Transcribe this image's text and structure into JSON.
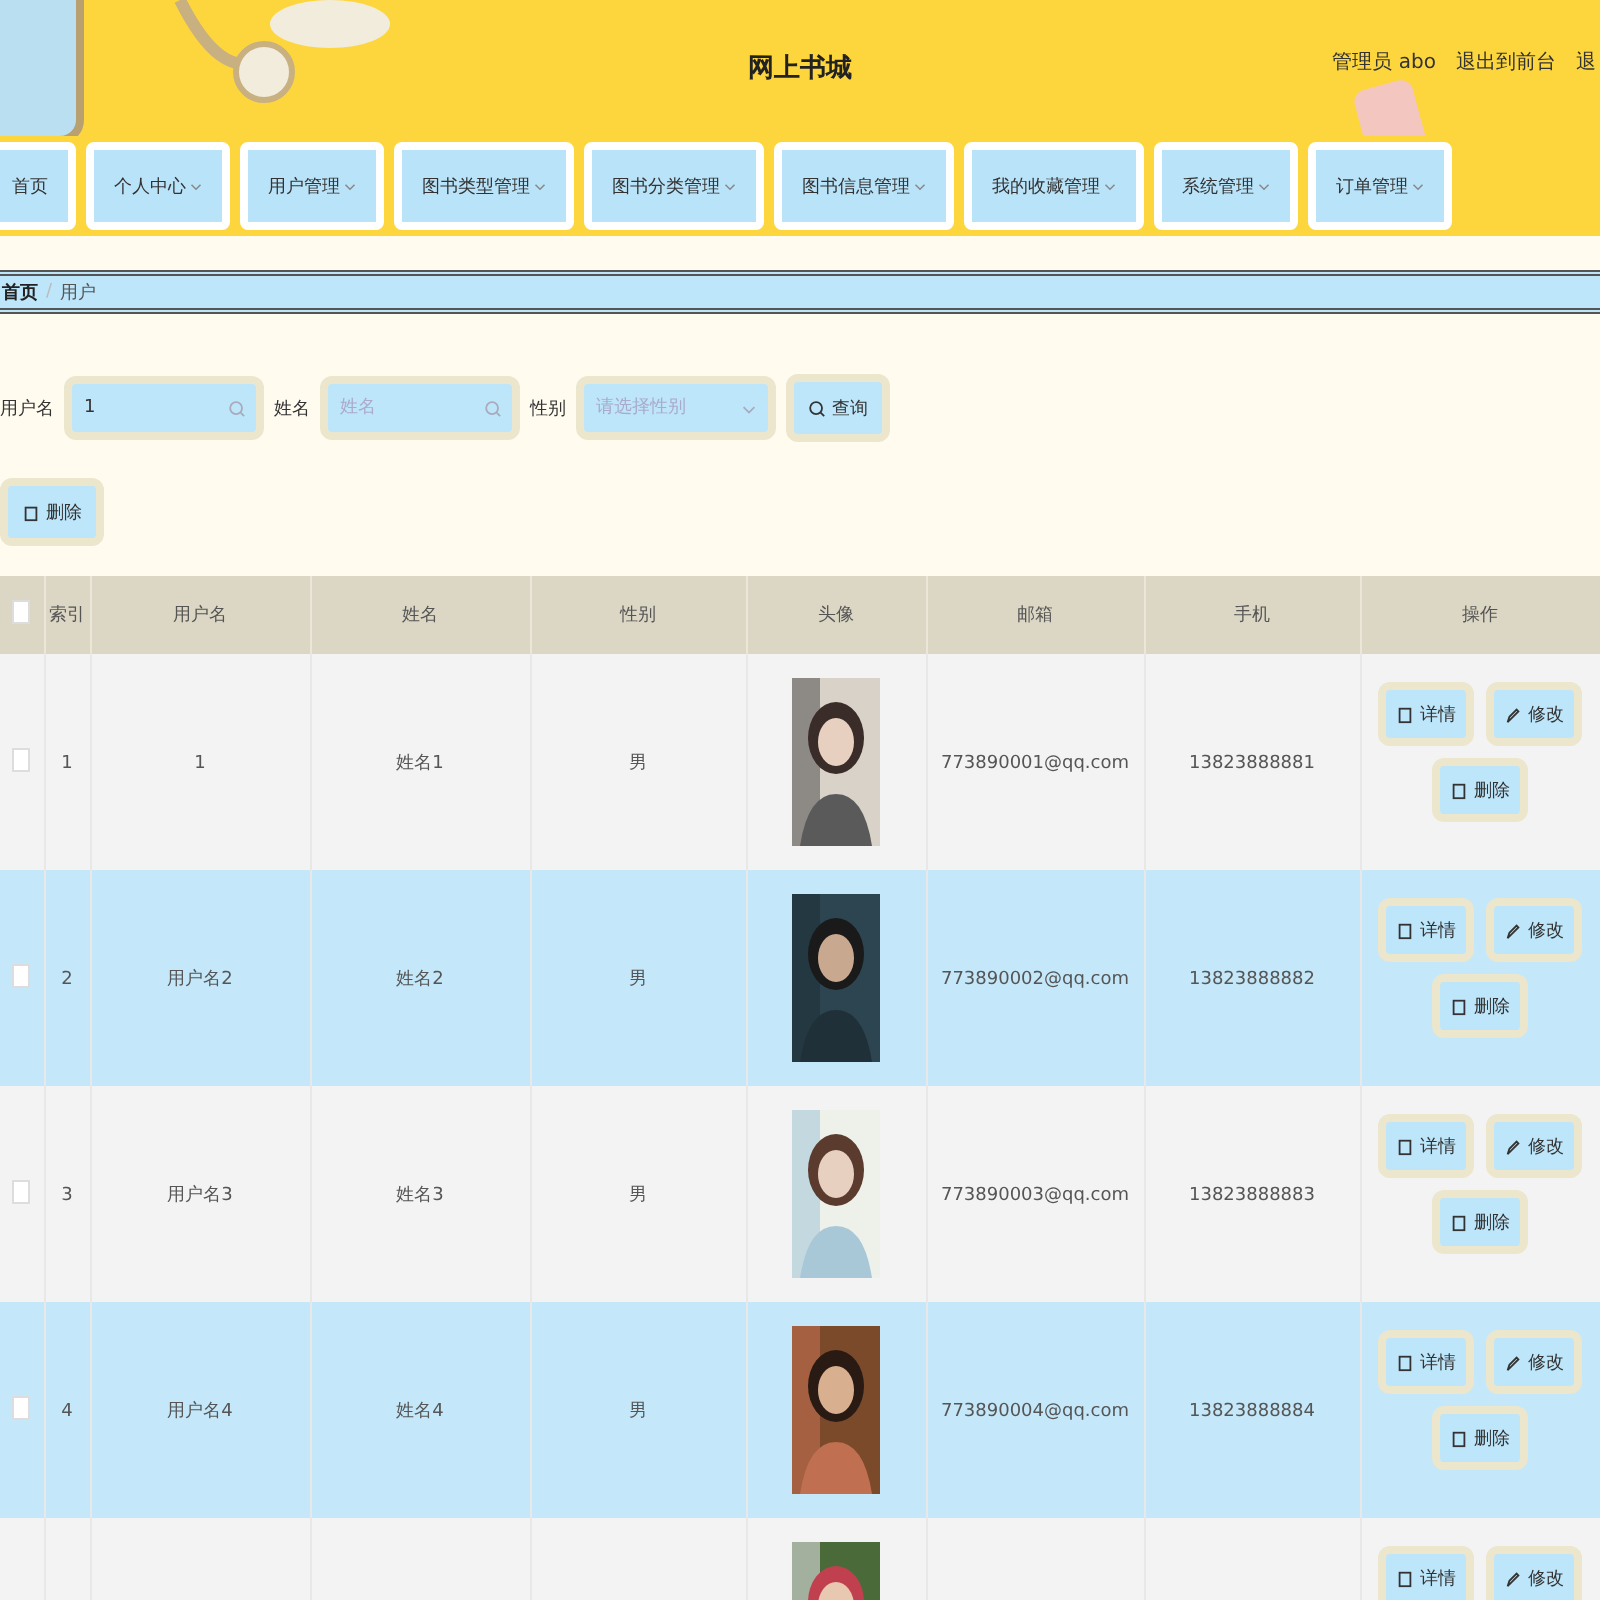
{
  "header": {
    "title": "网上书城",
    "links": [
      "管理员 abo",
      "退出到前台",
      "退"
    ]
  },
  "nav": [
    {
      "label": "首页",
      "dropdown": false
    },
    {
      "label": "个人中心",
      "dropdown": true
    },
    {
      "label": "用户管理",
      "dropdown": true
    },
    {
      "label": "图书类型管理",
      "dropdown": true
    },
    {
      "label": "图书分类管理",
      "dropdown": true
    },
    {
      "label": "图书信息管理",
      "dropdown": true
    },
    {
      "label": "我的收藏管理",
      "dropdown": true
    },
    {
      "label": "系统管理",
      "dropdown": true
    },
    {
      "label": "订单管理",
      "dropdown": true
    }
  ],
  "breadcrumb": {
    "items": [
      "首页",
      "用户"
    ],
    "separator": "/"
  },
  "search": {
    "fields": [
      {
        "label": "用户名",
        "kind": "text",
        "value": "1"
      },
      {
        "label": "姓名",
        "kind": "text",
        "placeholder": "姓名"
      },
      {
        "label": "性别",
        "kind": "select",
        "placeholder": "请选择性别"
      }
    ],
    "button": "查询"
  },
  "bulk_delete": "删除",
  "table": {
    "columns": [
      "索引",
      "用户名",
      "姓名",
      "性别",
      "头像",
      "邮箱",
      "手机",
      "操作"
    ],
    "all_checked": false,
    "rows": [
      {
        "checked": false,
        "cells": [
          "1",
          "1",
          "姓名1",
          "男",
          "",
          "773890001@qq.com",
          "13823888881"
        ],
        "actions": [
          "详情",
          "修改",
          "删除"
        ]
      },
      {
        "checked": false,
        "cells": [
          "2",
          "用户名2",
          "姓名2",
          "男",
          "",
          "773890002@qq.com",
          "13823888882"
        ],
        "actions": [
          "详情",
          "修改",
          "删除"
        ]
      },
      {
        "checked": false,
        "cells": [
          "3",
          "用户名3",
          "姓名3",
          "男",
          "",
          "773890003@qq.com",
          "13823888883"
        ],
        "actions": [
          "详情",
          "修改",
          "删除"
        ]
      },
      {
        "checked": false,
        "cells": [
          "4",
          "用户名4",
          "姓名4",
          "男",
          "",
          "773890004@qq.com",
          "13823888884"
        ],
        "actions": [
          "详情",
          "修改",
          "删除"
        ]
      },
      {
        "cells": [
          "",
          "",
          "",
          "",
          "",
          "",
          ""
        ],
        "actions": [
          "详情",
          "修改"
        ]
      }
    ]
  }
}
